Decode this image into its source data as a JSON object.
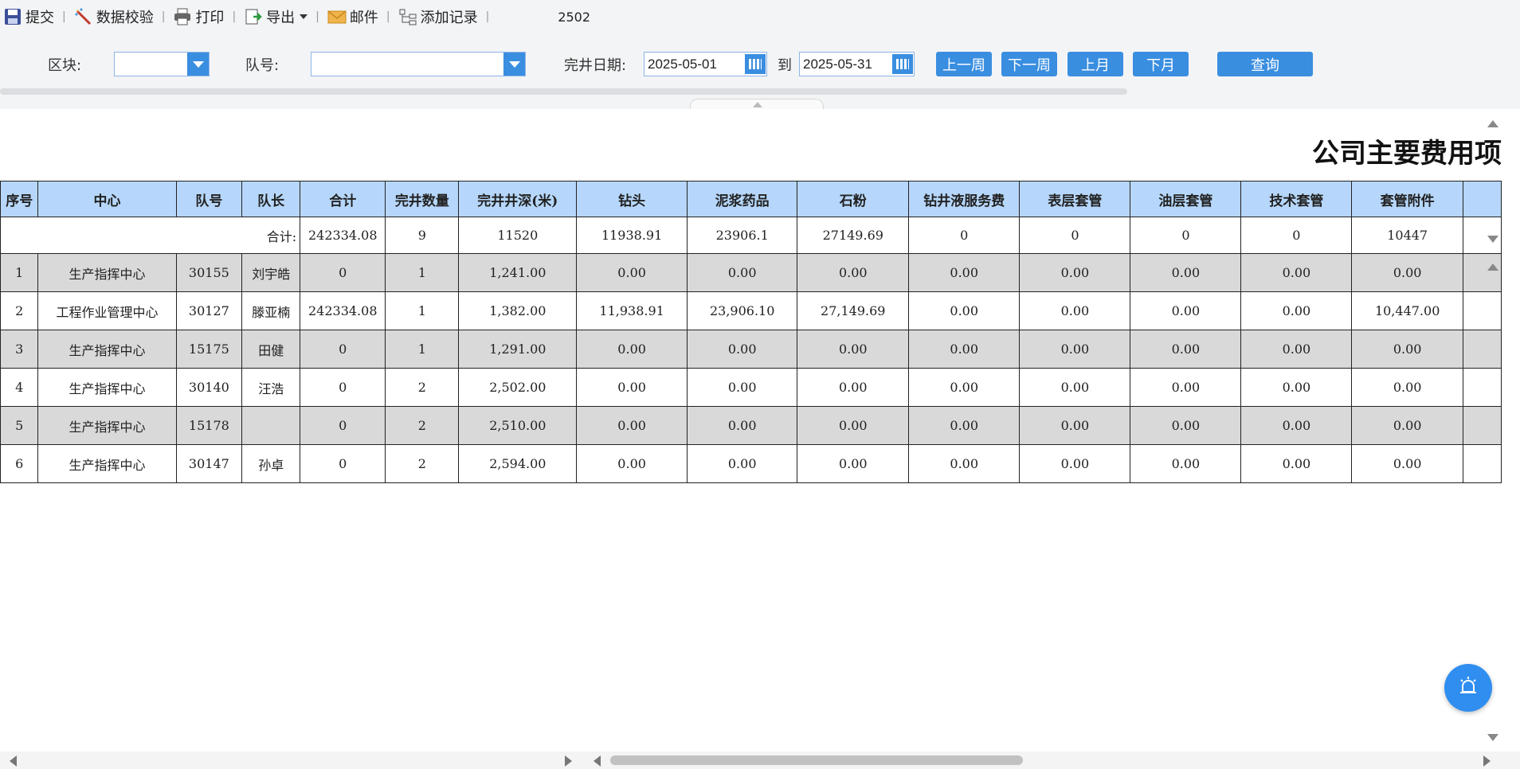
{
  "toolbar": {
    "submit": "提交",
    "validate": "数据校验",
    "print": "打印",
    "export": "导出",
    "mail": "邮件",
    "add_record": "添加记录",
    "code": "2502"
  },
  "filters": {
    "block_label": "区块:",
    "block_value": "",
    "team_label": "队号:",
    "team_value": "",
    "date_label": "完井日期:",
    "date_from": "2025-05-01",
    "to_label": "到",
    "date_to": "2025-05-31",
    "prev_week": "上一周",
    "next_week": "下一周",
    "prev_month": "上月",
    "next_month": "下月",
    "query": "查询"
  },
  "report": {
    "title": "公司主要费用项目",
    "columns": [
      "序号",
      "中心",
      "队号",
      "队长",
      "合计",
      "完井数量",
      "完井井深(米)",
      "钻头",
      "泥浆药品",
      "石粉",
      "钻井液服务费",
      "表层套管",
      "油层套管",
      "技术套管",
      "套管附件"
    ],
    "summary": {
      "label": "合计:",
      "values": [
        "242334.08",
        "9",
        "11520",
        "11938.91",
        "23906.1",
        "27149.69",
        "0",
        "0",
        "0",
        "0",
        "10447"
      ]
    },
    "rows": [
      [
        "1",
        "生产指挥中心",
        "30155",
        "刘宇皓",
        "0",
        "1",
        "1,241.00",
        "0.00",
        "0.00",
        "0.00",
        "0.00",
        "0.00",
        "0.00",
        "0.00",
        "0.00"
      ],
      [
        "2",
        "工程作业管理中心",
        "30127",
        "滕亚楠",
        "242334.08",
        "1",
        "1,382.00",
        "11,938.91",
        "23,906.10",
        "27,149.69",
        "0.00",
        "0.00",
        "0.00",
        "0.00",
        "10,447.00"
      ],
      [
        "3",
        "生产指挥中心",
        "15175",
        "田健",
        "0",
        "1",
        "1,291.00",
        "0.00",
        "0.00",
        "0.00",
        "0.00",
        "0.00",
        "0.00",
        "0.00",
        "0.00"
      ],
      [
        "4",
        "生产指挥中心",
        "30140",
        "汪浩",
        "0",
        "2",
        "2,502.00",
        "0.00",
        "0.00",
        "0.00",
        "0.00",
        "0.00",
        "0.00",
        "0.00",
        "0.00"
      ],
      [
        "5",
        "生产指挥中心",
        "15178",
        "",
        "0",
        "2",
        "2,510.00",
        "0.00",
        "0.00",
        "0.00",
        "0.00",
        "0.00",
        "0.00",
        "0.00",
        "0.00"
      ],
      [
        "6",
        "生产指挥中心",
        "30147",
        "孙卓",
        "0",
        "2",
        "2,594.00",
        "0.00",
        "0.00",
        "0.00",
        "0.00",
        "0.00",
        "0.00",
        "0.00",
        "0.00"
      ]
    ]
  },
  "icons": {
    "submit": "save-icon",
    "validate": "wand-icon",
    "print": "printer-icon",
    "export": "export-icon",
    "mail": "envelope-icon",
    "add_record": "tree-add-icon",
    "calendar": "calendar-icon",
    "fab": "alarm-icon"
  },
  "colors": {
    "accent": "#3a8ee0",
    "header_bg": "#b6d7fb",
    "stripe": "#d9d9d9"
  }
}
